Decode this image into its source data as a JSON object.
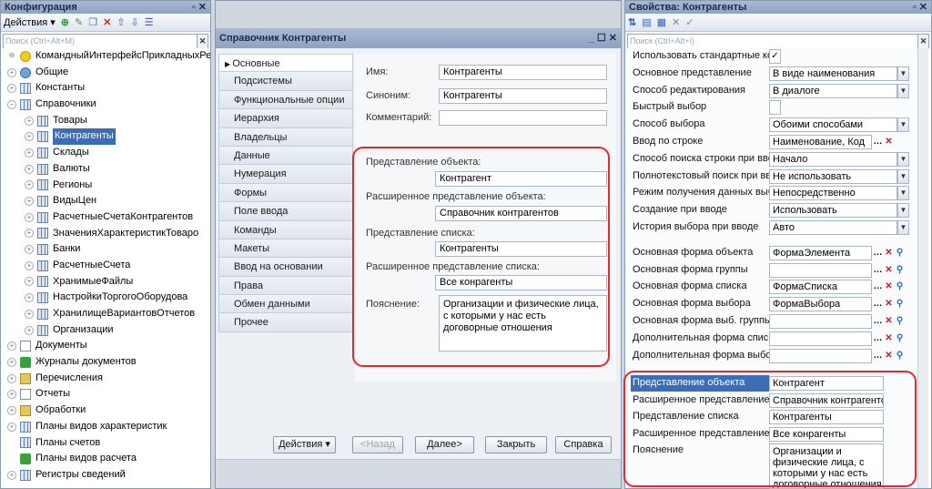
{
  "left": {
    "title": "Конфигурация",
    "actions_label": "Действия",
    "search_placeholder": "Поиск (Ctrl+Alt+M)",
    "root": "КомандныйИнтерфейсПрикладныхРеш",
    "items": [
      {
        "label": "Общие",
        "level": 1,
        "icon": "gear-icon"
      },
      {
        "label": "Константы",
        "level": 1,
        "icon": "constants-icon"
      },
      {
        "label": "Справочники",
        "level": 1,
        "icon": "catalog-icon",
        "expanded": true
      },
      {
        "label": "Товары",
        "level": 2,
        "icon": "table-icon"
      },
      {
        "label": "Контрагенты",
        "level": 2,
        "icon": "table-icon",
        "selected": true
      },
      {
        "label": "Склады",
        "level": 2,
        "icon": "table-icon"
      },
      {
        "label": "Валюты",
        "level": 2,
        "icon": "table-icon"
      },
      {
        "label": "Регионы",
        "level": 2,
        "icon": "table-icon"
      },
      {
        "label": "ВидыЦен",
        "level": 2,
        "icon": "table-icon"
      },
      {
        "label": "РасчетныеСчетаКонтрагентов",
        "level": 2,
        "icon": "table-icon"
      },
      {
        "label": "ЗначенияХарактеристикТоваро",
        "level": 2,
        "icon": "table-icon"
      },
      {
        "label": "Банки",
        "level": 2,
        "icon": "table-icon"
      },
      {
        "label": "РасчетныеСчета",
        "level": 2,
        "icon": "table-icon"
      },
      {
        "label": "ХранимыеФайлы",
        "level": 2,
        "icon": "table-icon"
      },
      {
        "label": "НастройкиТоргогоОборудова",
        "level": 2,
        "icon": "table-icon"
      },
      {
        "label": "ХранилищеВариантовОтчетов",
        "level": 2,
        "icon": "table-icon"
      },
      {
        "label": "Организации",
        "level": 2,
        "icon": "table-icon"
      },
      {
        "label": "Документы",
        "level": 1,
        "icon": "document-icon"
      },
      {
        "label": "Журналы документов",
        "level": 1,
        "icon": "journal-icon"
      },
      {
        "label": "Перечисления",
        "level": 1,
        "icon": "enum-icon"
      },
      {
        "label": "Отчеты",
        "level": 1,
        "icon": "report-icon"
      },
      {
        "label": "Обработки",
        "level": 1,
        "icon": "processing-icon"
      },
      {
        "label": "Планы видов характеристик",
        "level": 1,
        "icon": "chart-types-icon"
      },
      {
        "label": "Планы счетов",
        "level": 1,
        "icon": "accounts-icon",
        "noexpand": true
      },
      {
        "label": "Планы видов расчета",
        "level": 1,
        "icon": "calc-types-icon",
        "noexpand": true
      },
      {
        "label": "Регистры сведений",
        "level": 1,
        "icon": "register-icon"
      }
    ]
  },
  "middle": {
    "title": "Справочник Контрагенты",
    "tabs": [
      "Основные",
      "Подсистемы",
      "Функциональные опции",
      "Иерархия",
      "Владельцы",
      "Данные",
      "Нумерация",
      "Формы",
      "Поле ввода",
      "Команды",
      "Макеты",
      "Ввод на основании",
      "Права",
      "Обмен данными",
      "Прочее"
    ],
    "name_label": "Имя:",
    "name_value": "Контрагенты",
    "synonym_label": "Синоним:",
    "synonym_value": "Контрагенты",
    "comment_label": "Комментарий:",
    "comment_value": "",
    "obj_repr_label": "Представление объекта:",
    "obj_repr_value": "Контрагент",
    "ext_obj_repr_label": "Расширенное представление объекта:",
    "ext_obj_repr_value": "Справочник контрагентов",
    "list_repr_label": "Представление списка:",
    "list_repr_value": "Контрагенты",
    "ext_list_repr_label": "Расширенное представление списка:",
    "ext_list_repr_value": "Все конрагенты",
    "explain_label": "Пояснение:",
    "explain_value": "Организации и физические лица, с которыми у нас есть договорные отношения",
    "btn_actions": "Действия",
    "btn_back": "<Назад",
    "btn_next": "Далее>",
    "btn_close": "Закрыть",
    "btn_help": "Справка"
  },
  "right": {
    "title": "Свойства: Контрагенты",
    "search_placeholder": "Поиск (Ctrl+Alt+I)",
    "props": [
      {
        "name": "Использовать стандартные ко",
        "value": "✓",
        "kind": "check"
      },
      {
        "name": "Основное представление",
        "value": "В виде наименования",
        "kind": "select"
      },
      {
        "name": "Способ редактирования",
        "value": "В диалоге",
        "kind": "select"
      },
      {
        "name": "Быстрый выбор",
        "value": "",
        "kind": "check"
      },
      {
        "name": "Способ выбора",
        "value": "Обоими способами",
        "kind": "select"
      },
      {
        "name": "Ввод по строке",
        "value": "Наименование, Код",
        "kind": "list"
      },
      {
        "name": "Способ поиска строки при вво",
        "value": "Начало",
        "kind": "select"
      },
      {
        "name": "Полнотекстовый поиск при вв",
        "value": "Не использовать",
        "kind": "select"
      },
      {
        "name": "Режим получения данных выбс",
        "value": "Непосредственно",
        "kind": "select"
      },
      {
        "name": "Создание при вводе",
        "value": "Использовать",
        "kind": "select"
      },
      {
        "name": "История выбора при вводе",
        "value": "Авто",
        "kind": "select"
      },
      {
        "name": "Основная форма объекта",
        "value": "ФормаЭлемента",
        "kind": "form"
      },
      {
        "name": "Основная форма группы",
        "value": "",
        "kind": "form"
      },
      {
        "name": "Основная форма списка",
        "value": "ФормаСписка",
        "kind": "form"
      },
      {
        "name": "Основная форма выбора",
        "value": "ФормаВыбора",
        "kind": "form"
      },
      {
        "name": "Основная форма выб. группы",
        "value": "",
        "kind": "form"
      },
      {
        "name": "Дополнительная форма списк",
        "value": "",
        "kind": "form"
      },
      {
        "name": "Дополнительная форма выбор",
        "value": "",
        "kind": "form"
      },
      {
        "name": "Представление объекта",
        "value": "Контрагент",
        "kind": "text",
        "highlight": true
      },
      {
        "name": "Расширенное представление о",
        "value": "Справочник контрагентов",
        "kind": "text"
      },
      {
        "name": "Представление списка",
        "value": "Контрагенты",
        "kind": "text"
      },
      {
        "name": "Расширенное представление с",
        "value": "Все конрагенты",
        "kind": "text"
      },
      {
        "name": "Пояснение",
        "value": "Организации и физические лица, с которыми у нас есть договорные отношения",
        "kind": "multi"
      }
    ]
  }
}
